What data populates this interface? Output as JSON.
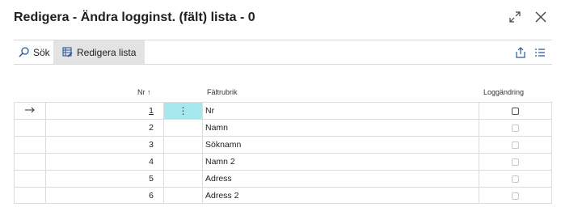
{
  "page": {
    "title": "Redigera - Ändra logginst. (fält) lista - 0"
  },
  "window_icons": [
    {
      "name": "expand-icon"
    },
    {
      "name": "close-icon"
    }
  ],
  "toolbar": {
    "search_label": "Sök",
    "edit_list_label": "Redigera lista"
  },
  "columns": {
    "nr": "Nr",
    "nr_sort": "↑",
    "field_caption": "Fältrubrik",
    "log_change": "Loggändring"
  },
  "rows": [
    {
      "nr": "1",
      "caption": "Nr",
      "log_change": false,
      "selected": true
    },
    {
      "nr": "2",
      "caption": "Namn",
      "log_change": false,
      "selected": false
    },
    {
      "nr": "3",
      "caption": "Söknamn",
      "log_change": false,
      "selected": false
    },
    {
      "nr": "4",
      "caption": "Namn 2",
      "log_change": false,
      "selected": false
    },
    {
      "nr": "5",
      "caption": "Adress",
      "log_change": false,
      "selected": false
    },
    {
      "nr": "6",
      "caption": "Adress 2",
      "log_change": false,
      "selected": false
    }
  ]
}
